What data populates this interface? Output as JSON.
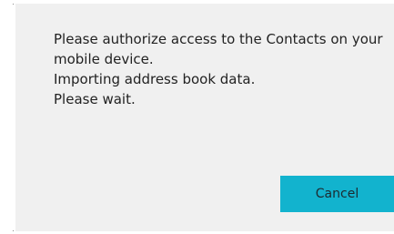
{
  "dialog": {
    "message_lines": [
      "Please authorize access to the Contacts on your",
      "mobile device.",
      "Importing address book data.",
      "Please wait."
    ],
    "cancel_label": "Cancel"
  },
  "colors": {
    "dialog_background": "#f0f0f0",
    "button_accent": "#12b3ce",
    "text": "#222222"
  }
}
